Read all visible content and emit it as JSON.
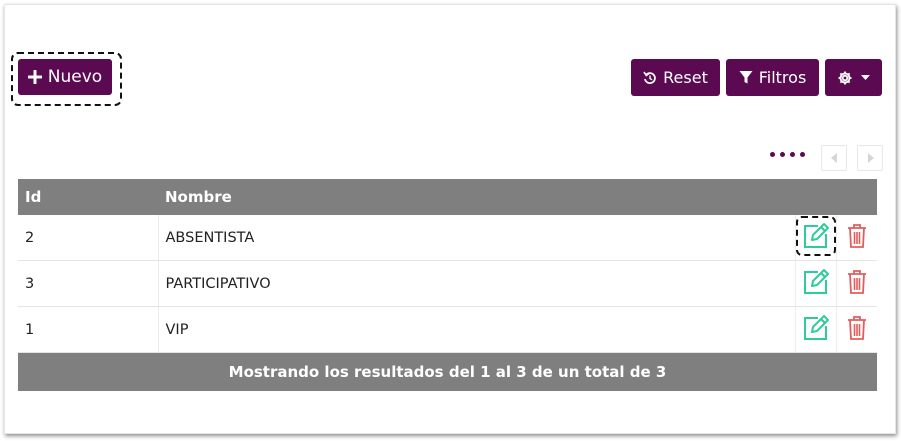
{
  "toolbar": {
    "new_label": "Nuevo",
    "reset_label": "Reset",
    "filters_label": "Filtros"
  },
  "table": {
    "headers": [
      "Id",
      "Nombre"
    ],
    "rows": [
      {
        "id": "2",
        "nombre": "ABSENTISTA"
      },
      {
        "id": "3",
        "nombre": "PARTICIPATIVO"
      },
      {
        "id": "1",
        "nombre": "VIP"
      }
    ],
    "footer": "Mostrando los resultados del 1 al 3 de un total de 3"
  },
  "colors": {
    "brand": "#5b0a52",
    "header_gray": "#7f7f7f",
    "edit_green": "#2ecc9a",
    "delete_red": "#e35d5d"
  },
  "icons": [
    "plus-icon",
    "reset-icon",
    "filter-icon",
    "gear-icon",
    "caret-down-icon",
    "chevron-left-icon",
    "chevron-right-icon",
    "edit-icon",
    "trash-icon"
  ]
}
